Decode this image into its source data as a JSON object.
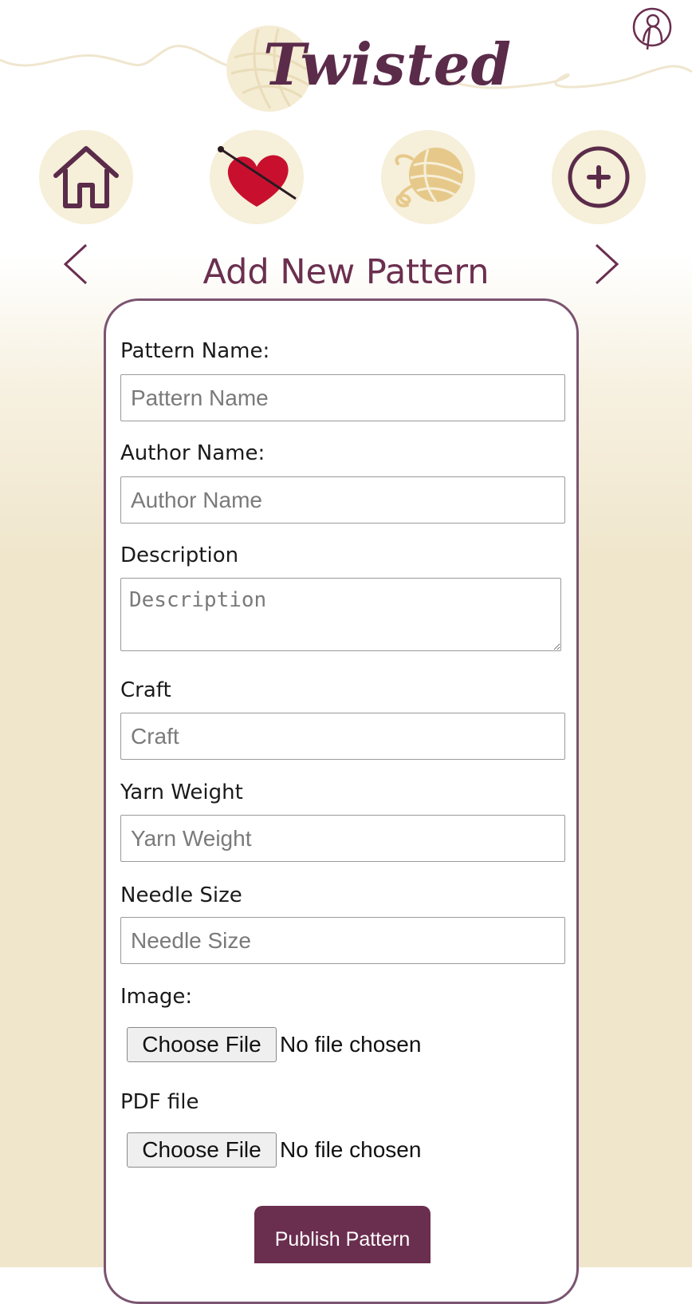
{
  "brand": {
    "name": "Twisted"
  },
  "nav": {
    "items": [
      {
        "icon": "home-icon"
      },
      {
        "icon": "heart-needle-icon"
      },
      {
        "icon": "yarn-ball-icon"
      },
      {
        "icon": "plus-circle-icon"
      }
    ]
  },
  "page": {
    "title": "Add New Pattern"
  },
  "form": {
    "pattern_name": {
      "label": "Pattern Name:",
      "placeholder": "Pattern Name"
    },
    "author_name": {
      "label": "Author Name:",
      "placeholder": "Author Name"
    },
    "description": {
      "label": "Description",
      "placeholder": "Description"
    },
    "craft": {
      "label": "Craft",
      "placeholder": "Craft"
    },
    "yarn_weight": {
      "label": "Yarn Weight",
      "placeholder": "Yarn Weight"
    },
    "needle_size": {
      "label": "Needle Size",
      "placeholder": "Needle Size"
    },
    "image": {
      "label": "Image:",
      "button": "Choose File",
      "status": "No file chosen"
    },
    "pdf": {
      "label": "PDF file",
      "button": "Choose File",
      "status": "No file chosen"
    },
    "submit": "Publish Pattern"
  },
  "colors": {
    "accent": "#6a2e4f",
    "cream": "#f6efd9",
    "heart": "#c8102e",
    "yarn": "#e6c98a"
  }
}
